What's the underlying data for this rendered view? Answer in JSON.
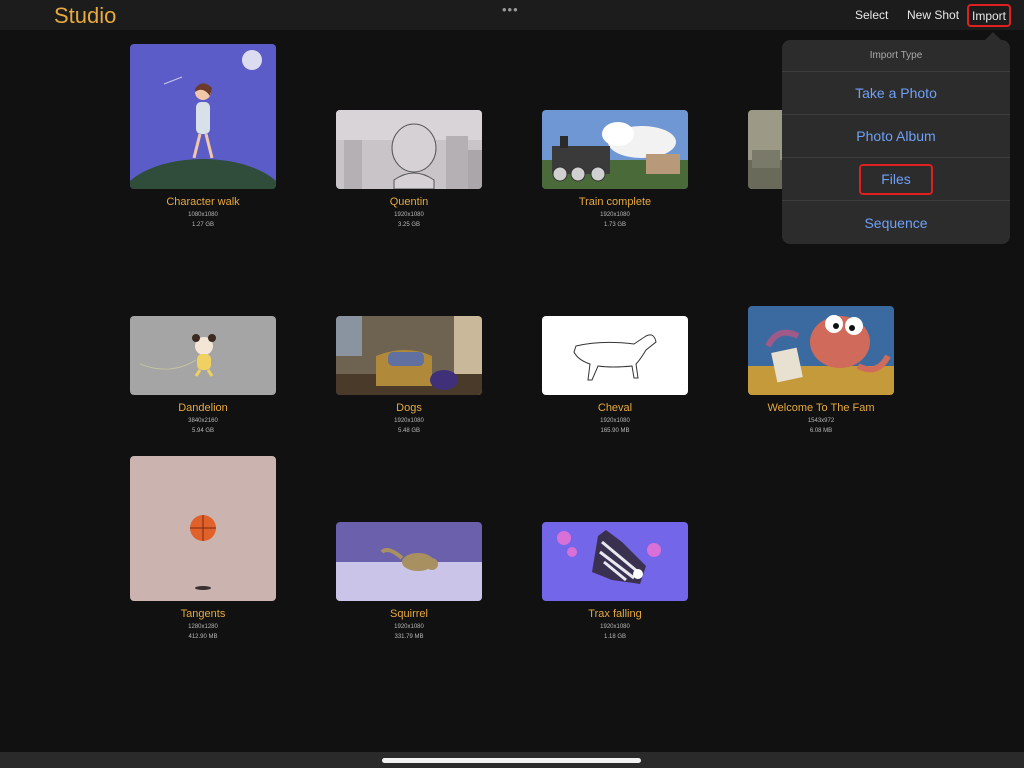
{
  "app": {
    "title": "Studio"
  },
  "topbar": {
    "more_icon": "ellipsis-icon",
    "more_glyph": "•••",
    "select_label": "Select",
    "new_shot_label": "New Shot",
    "import_label": "Import"
  },
  "import_menu": {
    "header": "Import Type",
    "items": [
      "Take a Photo",
      "Photo Album",
      "Files",
      "Sequence"
    ],
    "highlighted_item": "Files"
  },
  "projects": [
    {
      "name": "Character walk",
      "resolution": "1080x1080",
      "size": "1.27 GB"
    },
    {
      "name": "Quentin",
      "resolution": "1920x1080",
      "size": "3.25 GB"
    },
    {
      "name": "Train complete",
      "resolution": "1920x1080",
      "size": "1.73 GB"
    },
    {
      "name": "",
      "resolution": "",
      "size": ""
    },
    {
      "name": "Dandelion",
      "resolution": "3840x2160",
      "size": "5.94 GB"
    },
    {
      "name": "Dogs",
      "resolution": "1920x1080",
      "size": "5.48 GB"
    },
    {
      "name": "Cheval",
      "resolution": "1920x1080",
      "size": "165.90 MB"
    },
    {
      "name": "Welcome To The Fam",
      "resolution": "1543x972",
      "size": "6.08 MB"
    },
    {
      "name": "Tangents",
      "resolution": "1280x1280",
      "size": "412.90 MB"
    },
    {
      "name": "Squirrel",
      "resolution": "1920x1080",
      "size": "331.79 MB"
    },
    {
      "name": "Trax falling",
      "resolution": "1920x1080",
      "size": "1.18 GB"
    }
  ],
  "colors": {
    "accent": "#e6a93f",
    "menu_text": "#6fa0f5",
    "highlight": "#e0201e",
    "background": "#111111"
  }
}
